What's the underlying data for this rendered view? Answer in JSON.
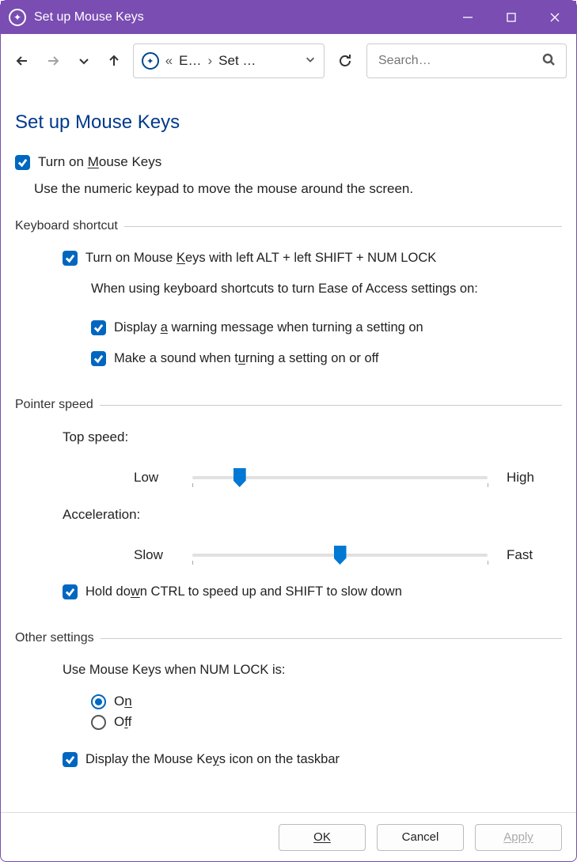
{
  "window": {
    "title": "Set up Mouse Keys"
  },
  "breadcrumb": {
    "ellipsis": "«",
    "part1": "E…",
    "sep": "›",
    "part2": "Set …"
  },
  "search": {
    "placeholder": "Search…"
  },
  "page": {
    "title": "Set up Mouse Keys"
  },
  "main_toggle": {
    "prefix": "Turn on ",
    "uchar": "M",
    "suffix": "ouse Keys",
    "checked": true
  },
  "description": "Use the numeric keypad to move the mouse around the screen.",
  "groups": {
    "keyboard_shortcut": "Keyboard shortcut",
    "pointer_speed": "Pointer speed",
    "other_settings": "Other settings"
  },
  "kbd": {
    "enable": {
      "prefix": "Turn on Mouse ",
      "uchar": "K",
      "suffix": "eys with left ALT + left SHIFT + NUM LOCK",
      "checked": true
    },
    "intro": "When using keyboard shortcuts to turn Ease of Access settings on:",
    "warn": {
      "prefix": "Display ",
      "uchar": "a",
      "suffix": " warning message when turning a setting on",
      "checked": true
    },
    "sound": {
      "prefix": "Make a sound when t",
      "uchar": "u",
      "suffix": "rning a setting on or off",
      "checked": true
    }
  },
  "sliders": {
    "top_speed": {
      "label": "Top speed:",
      "min": "Low",
      "max": "High",
      "value_percent": 16
    },
    "acceleration": {
      "label": "Acceleration:",
      "min": "Slow",
      "max": "Fast",
      "value_percent": 50
    }
  },
  "hold_ctrl": {
    "prefix": "Hold do",
    "uchar": "w",
    "suffix": "n CTRL to speed up and SHIFT to slow down",
    "checked": true
  },
  "numlock": {
    "label": "Use Mouse Keys when NUM LOCK is:",
    "on": {
      "prefix": "O",
      "uchar": "n",
      "selected": true
    },
    "off": {
      "prefix": "O",
      "uchar": "f",
      "suffix": "f",
      "selected": false
    }
  },
  "taskbar_icon": {
    "prefix": "Display the Mouse Ke",
    "uchar": "y",
    "suffix": "s icon on the taskbar",
    "checked": true
  },
  "buttons": {
    "ok": "OK",
    "cancel": "Cancel",
    "apply": "Apply"
  }
}
